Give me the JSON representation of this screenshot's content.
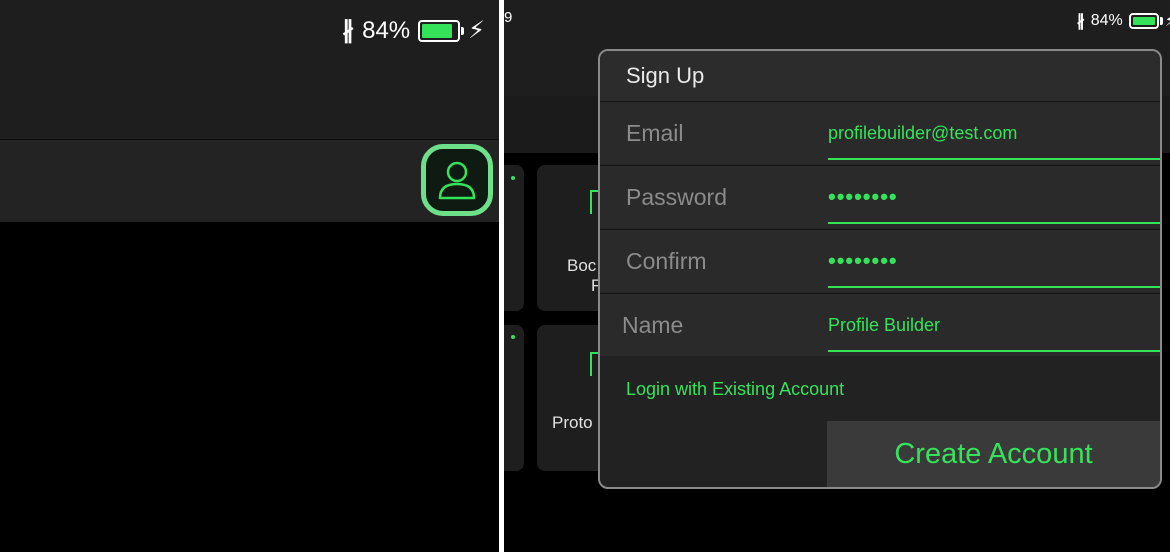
{
  "status": {
    "battery_percent_text": "84%",
    "time_fragment": "9",
    "battery_level": 0.84,
    "accent_color": "#35e35a"
  },
  "tiles": {
    "label_1": "Boc",
    "label_1b": "F",
    "label_2": "Proto"
  },
  "signup": {
    "title": "Sign Up",
    "fields": [
      {
        "label": "Email",
        "value": "profilebuilder@test.com"
      },
      {
        "label": "Password",
        "value": "••••••••"
      },
      {
        "label": "Confirm",
        "value": "••••••••"
      },
      {
        "label": "Name",
        "value": "Profile Builder"
      }
    ],
    "login_link": "Login with Existing Account",
    "create_button": "Create Account"
  },
  "icons": {
    "profile": "person-outline-icon",
    "bluetooth": "bluetooth-icon",
    "battery": "battery-icon",
    "charging": "bolt-icon"
  }
}
